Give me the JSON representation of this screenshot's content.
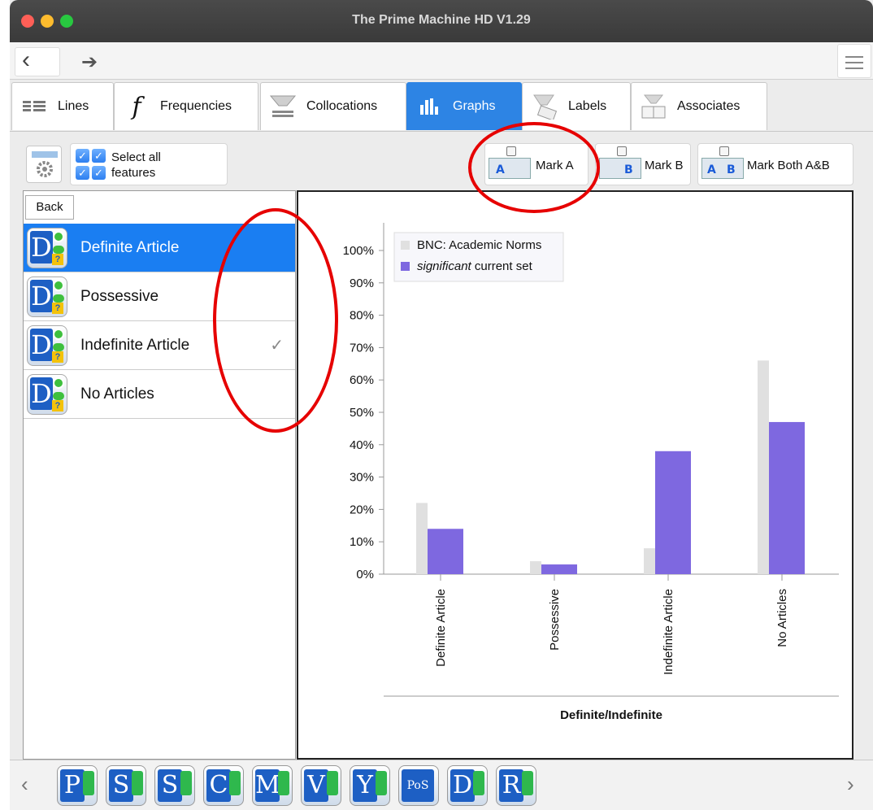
{
  "window": {
    "title": "The Prime Machine HD V1.29"
  },
  "tabs": [
    {
      "label": "Lines",
      "icon": "lines-icon"
    },
    {
      "label": "Frequencies",
      "icon": "function-icon"
    },
    {
      "label": "Collocations",
      "icon": "collocations-icon"
    },
    {
      "label": "Graphs",
      "icon": "bar-chart-icon",
      "active": true
    },
    {
      "label": "Labels",
      "icon": "labels-icon"
    },
    {
      "label": "Associates",
      "icon": "associates-icon"
    }
  ],
  "toolbar": {
    "select_all_line1": "Select all",
    "select_all_line2": "features",
    "mark_a": "Mark A",
    "mark_b": "Mark B",
    "mark_both": "Mark Both A&B",
    "card_a": "A",
    "card_b": "B"
  },
  "left_panel": {
    "back_label": "Back",
    "items": [
      {
        "label": "Definite Article",
        "selected": true,
        "checked": false
      },
      {
        "label": "Possessive",
        "selected": false,
        "checked": false
      },
      {
        "label": "Indefinite Article",
        "selected": false,
        "checked": true
      },
      {
        "label": "No Articles",
        "selected": false,
        "checked": false
      }
    ],
    "checkmark": "✓"
  },
  "chart_data": {
    "type": "bar",
    "categories": [
      "Definite Article",
      "Possessive",
      "Indefinite Article",
      "No Articles"
    ],
    "series": [
      {
        "name": "BNC: Academic Norms",
        "values": [
          22,
          4,
          8,
          66
        ],
        "color": "#e0e0e0"
      },
      {
        "name": "current set",
        "name_emphasis": "significant",
        "values": [
          14,
          3,
          38,
          47
        ],
        "color": "#7e68e0"
      }
    ],
    "ylim": [
      0,
      100
    ],
    "yticks": [
      "0%",
      "10%",
      "20%",
      "30%",
      "40%",
      "50%",
      "60%",
      "70%",
      "80%",
      "90%",
      "100%"
    ],
    "xlabel": "Definite/Indefinite",
    "legend_position": "top-left",
    "grid": false
  },
  "dock": {
    "icons": [
      "P",
      "S",
      "S",
      "C",
      "M",
      "V",
      "Y",
      "PoS",
      "D",
      "R"
    ],
    "prev": "‹",
    "next": "›"
  },
  "colors": {
    "accent": "#2d84e4",
    "annotation": "#e60000"
  }
}
